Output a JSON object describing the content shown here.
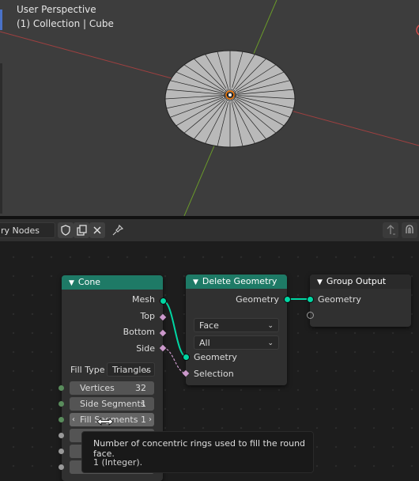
{
  "viewport": {
    "view_name": "User Perspective",
    "object_info": "(1) Collection | Cube"
  },
  "header": {
    "tree_name": "ry Nodes",
    "fake_user_icon": "shield-icon",
    "duplicate_icon": "duplicate-icon",
    "unlink_icon": "close-icon",
    "pin_icon": "pin-icon",
    "parent_icon": "arrow-up-icon",
    "snap_icon": "magnet-icon"
  },
  "nodes": {
    "cone": {
      "title": "Cone",
      "outputs": [
        "Mesh",
        "Top",
        "Bottom",
        "Side"
      ],
      "fill_type_label": "Fill Type",
      "fill_type_value": "Triangles",
      "vertices": {
        "label": "Vertices",
        "value": "32"
      },
      "side_segments": {
        "label": "Side Segments",
        "value": "1"
      },
      "fill_segments": {
        "label": "Fill Segments",
        "value": "1"
      }
    },
    "delete_geometry": {
      "title": "Delete Geometry",
      "output": "Geometry",
      "domain": "Face",
      "mode": "All",
      "inputs": [
        "Geometry",
        "Selection"
      ]
    },
    "group_output": {
      "title": "Group Output",
      "input": "Geometry"
    }
  },
  "tooltip": {
    "description": "Number of concentric rings used to fill the round face.",
    "type_info": "1 (Integer)."
  },
  "colors": {
    "geometry_socket": "#00d6a3",
    "geometry_header": "#1e7a66",
    "boolean_socket": "#cc99cc",
    "integer_socket": "#598c5c"
  }
}
